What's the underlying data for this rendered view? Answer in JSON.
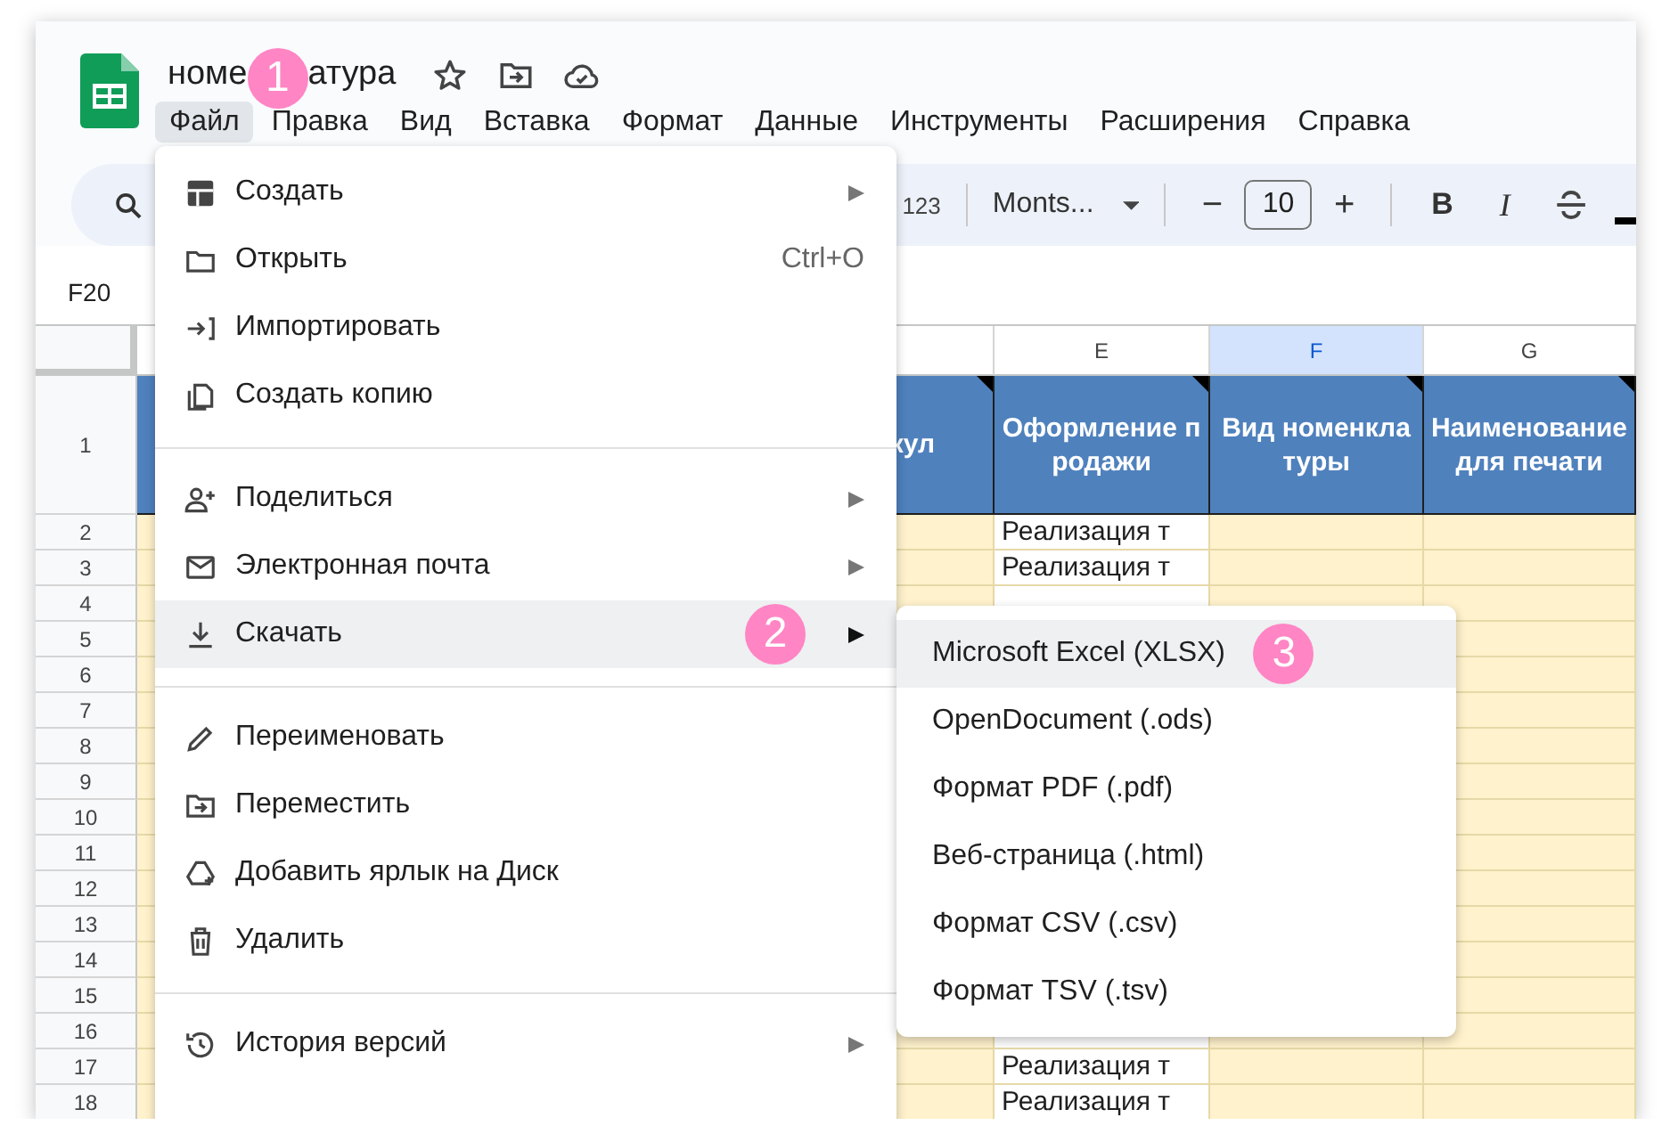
{
  "document": {
    "title_parts": [
      "номе",
      "атура"
    ],
    "menubar": [
      {
        "label": "Файл",
        "selected": true
      },
      {
        "label": "Правка",
        "selected": false
      },
      {
        "label": "Вид",
        "selected": false
      },
      {
        "label": "Вставка",
        "selected": false
      },
      {
        "label": "Формат",
        "selected": false
      },
      {
        "label": "Данные",
        "selected": false
      },
      {
        "label": "Инструменты",
        "selected": false
      },
      {
        "label": "Расширения",
        "selected": false
      },
      {
        "label": "Справка",
        "selected": false
      }
    ]
  },
  "toolbar": {
    "number_format": "123",
    "font": "Monts...",
    "decrease": "−",
    "font_size": "10",
    "increase": "+",
    "bold": "B",
    "italic": "I"
  },
  "name_box": "F20",
  "sheet": {
    "header_row_number": "1",
    "columns": [
      {
        "color": "#fff2cc"
      },
      {
        "header": "кул",
        "color": "#fff2cc",
        "selected": false,
        "note": true
      },
      {
        "letter": "E",
        "header": "Оформление продажи",
        "color": "#ffffff",
        "selected": false,
        "note": true
      },
      {
        "letter": "F",
        "header": "Вид номенклатуры",
        "color": "#fff2cc",
        "selected": true,
        "note": true
      },
      {
        "letter": "G",
        "header": "Наименование для печати",
        "color": "#fff2cc",
        "selected": false,
        "note": true
      }
    ],
    "rows": [
      {
        "number": "2",
        "cell_e": "Реализация т"
      },
      {
        "number": "3",
        "cell_e": "Реализация т"
      },
      {
        "number": "4"
      },
      {
        "number": "5"
      },
      {
        "number": "6"
      },
      {
        "number": "7"
      },
      {
        "number": "8"
      },
      {
        "number": "9"
      },
      {
        "number": "10"
      },
      {
        "number": "11"
      },
      {
        "number": "12"
      },
      {
        "number": "13"
      },
      {
        "number": "14"
      },
      {
        "number": "15"
      },
      {
        "number": "16"
      },
      {
        "number": "17",
        "cell_e": "Реализация т"
      },
      {
        "number": "18",
        "cell_e": "Реализация т"
      }
    ]
  },
  "file_menu": {
    "items": [
      {
        "kind": "item",
        "label": "Создать",
        "submenu": true,
        "selected": false
      },
      {
        "kind": "item",
        "label": "Открыть",
        "shortcut": "Ctrl+O",
        "submenu": false,
        "selected": false
      },
      {
        "kind": "item",
        "label": "Импортировать",
        "submenu": false,
        "selected": false
      },
      {
        "kind": "item",
        "label": "Создать копию",
        "submenu": false,
        "selected": false
      },
      {
        "kind": "divider"
      },
      {
        "kind": "item",
        "label": "Поделиться",
        "submenu": true,
        "selected": false
      },
      {
        "kind": "item",
        "label": "Электронная почта",
        "submenu": true,
        "selected": false
      },
      {
        "kind": "item",
        "label": "Скачать",
        "submenu": true,
        "selected": true
      },
      {
        "kind": "divider"
      },
      {
        "kind": "item",
        "label": "Переименовать",
        "submenu": false,
        "selected": false
      },
      {
        "kind": "item",
        "label": "Переместить",
        "submenu": false,
        "selected": false
      },
      {
        "kind": "item",
        "label": "Добавить ярлык на Диск",
        "submenu": false,
        "selected": false
      },
      {
        "kind": "item",
        "label": "Удалить",
        "submenu": false,
        "selected": false
      },
      {
        "kind": "divider"
      },
      {
        "kind": "item",
        "label": "История версий",
        "submenu": true,
        "selected": false
      }
    ]
  },
  "download_submenu": {
    "items": [
      {
        "label": "Microsoft Excel (XLSX)",
        "selected": true
      },
      {
        "label": "OpenDocument (.ods)",
        "selected": false
      },
      {
        "label": "Формат PDF (.pdf)",
        "selected": false
      },
      {
        "label": "Веб-страница (.html)",
        "selected": false
      },
      {
        "label": "Формат CSV (.csv)",
        "selected": false
      },
      {
        "label": "Формат TSV (.tsv)",
        "selected": false
      }
    ]
  },
  "callouts": [
    {
      "number": "1"
    },
    {
      "number": "2"
    },
    {
      "number": "3"
    }
  ]
}
